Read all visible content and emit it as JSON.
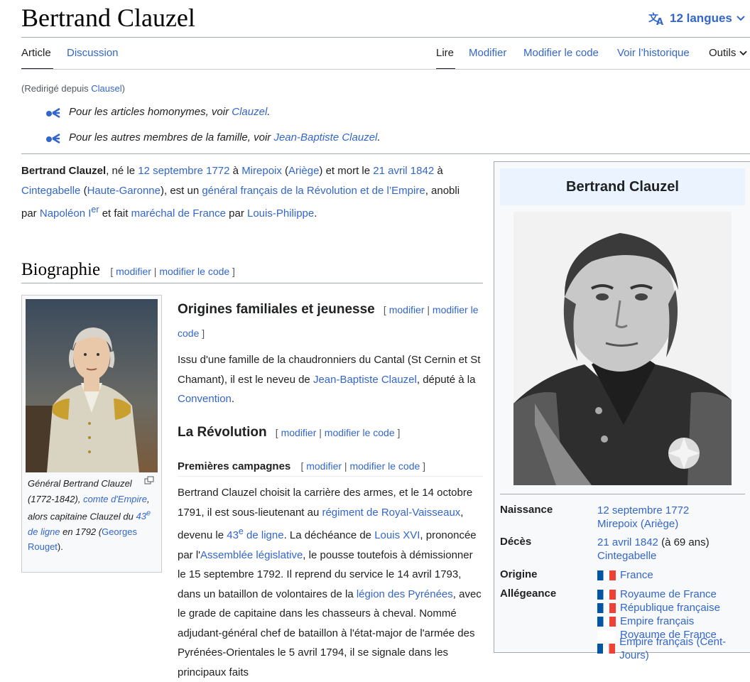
{
  "page": {
    "title": "Bertrand Clauzel",
    "languages_label": "12 langues"
  },
  "tabs": {
    "article": "Article",
    "discussion": "Discussion",
    "lire": "Lire",
    "modifier": "Modifier",
    "modifier_code": "Modifier le code",
    "historique": "Voir l’historique",
    "outils": "Outils"
  },
  "redirect": {
    "prefix": "(Redirigé depuis ",
    "link": "Clausel",
    "suffix": ")"
  },
  "hatnotes": [
    {
      "text": "Pour les articles homonymes, voir ",
      "link": "Clauzel",
      "end": "."
    },
    {
      "text": "Pour les autres membres de la famille, voir ",
      "link": "Jean-Baptiste Clauzel",
      "end": "."
    }
  ],
  "lead": {
    "bold": "Bertrand Clauzel",
    "t1": ", né le ",
    "l1": "12 septembre 1772",
    "t2": " à ",
    "l2": "Mirepoix",
    "t3": " (",
    "l3": "Ariège",
    "t4": ") et mort le ",
    "l4": "21 avril 1842",
    "t5": " à ",
    "l5": "Cintegabelle",
    "t6": " (",
    "l6": "Haute-Garonne",
    "t7": "), est un ",
    "l7": "général français de la Révolution et de l’Empire",
    "t8": ", anobli par ",
    "l8": "Napoléon I",
    "l8sup": "er",
    "t9": " et fait ",
    "l9": "maréchal de France",
    "t10": " par ",
    "l10": "Louis-Philippe",
    "t11": "."
  },
  "biographie": {
    "heading": "Biographie",
    "open": "[ ",
    "edit": "modifier",
    "sep": " | ",
    "edit_code": "modifier le code",
    "close": " ]"
  },
  "thumb": {
    "c1": "Général Bertrand Clauzel (1772-1842), ",
    "c2": "comte d'Empire",
    "c3": ", alors capitaine Clauzel du ",
    "c4": "43",
    "c4sup": "e",
    "c5": " de ligne",
    "c6": " en 1792 (",
    "c7": "Georges Rouget",
    "c8": ")."
  },
  "origines": {
    "heading": "Origines familiales et jeunesse",
    "text1": "Issu d'une famille de la chaudronniers du Cantal (St Cernin et St Chamant), il est le neveu de ",
    "link1": "Jean-Baptiste Clauzel",
    "text2": ", député à la ",
    "link2": "Convention",
    "text3": "."
  },
  "revolution": {
    "heading": "La Révolution"
  },
  "campagnes": {
    "heading": "Premières campagnes",
    "t1": "Bertrand Clauzel choisit la carrière des armes, et le 14 octobre 1791, il est sous-lieutenant au ",
    "l1": "régiment de Royal-Vaisseaux",
    "t2": ", devenu le ",
    "l2": "43",
    "l2sup": "e",
    "l2b": " de ligne",
    "t3": ". La déchéance de ",
    "l3": "Louis XVI",
    "t4": ", prononcée par l'",
    "l4": "Assemblée législative",
    "t5": ", le pousse toutefois à démissionner le 15 septembre 1792. Il reprend du service le 14 avril 1793, dans un bataillon de volontaires de la ",
    "l5": "légion des Pyrénées",
    "t6": ", avec le grade de capitaine dans les chasseurs à cheval. Nommé adjudant-général chef de bataillon à l'état-major de l'armée des Pyrénées-Orientales le 5 avril 1794, il se signale dans les principaux faits"
  },
  "infobox": {
    "title": "Bertrand Clauzel",
    "naissance_label": "Naissance",
    "naissance_date": "12 septembre 1772",
    "naissance_lieu": "Mirepoix (Ariège)",
    "deces_label": "Décès",
    "deces_date": "21 avril 1842",
    "deces_age": " (à 69 ans)",
    "deces_lieu": "Cintegabelle",
    "origine_label": "Origine",
    "origine_value": "France",
    "allegeance_label": "Allégeance",
    "allegeances": [
      "Royaume de France",
      "République française",
      "Empire français",
      "Royaume de France",
      "Empire français (Cent-Jours)"
    ]
  }
}
